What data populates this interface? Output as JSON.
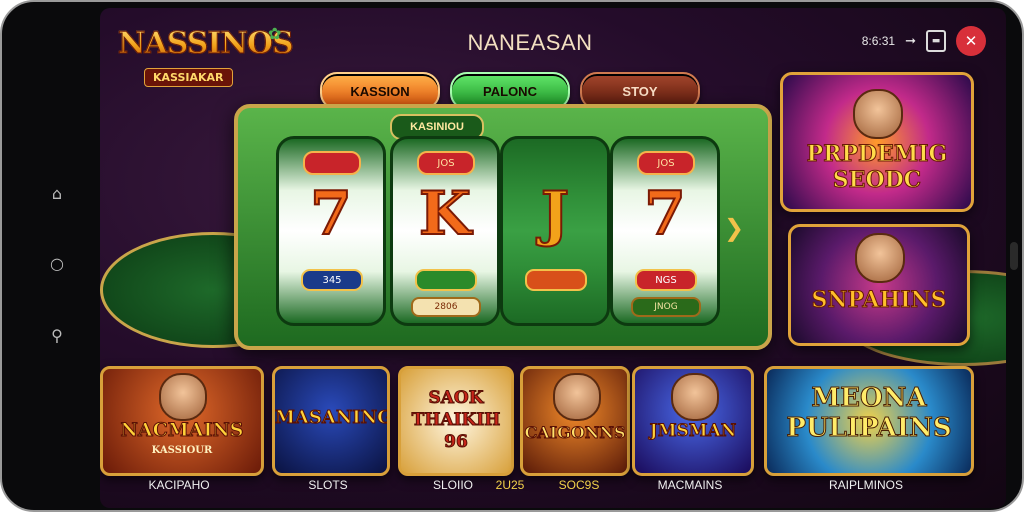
{
  "app": {
    "logo_title": "NASSINOS",
    "logo_subtitle": "KASSIAKAR",
    "title": "NANEASAN"
  },
  "status": {
    "time": "8:6:31"
  },
  "nav": {
    "home_icon": "home-icon",
    "back_icon": "circle-icon",
    "recent_icon": "lock-icon"
  },
  "tabs": [
    {
      "label": "KASSION",
      "color": "#e2560c"
    },
    {
      "label": "PALONC",
      "color": "#1e9a28"
    },
    {
      "label": "STOY",
      "color": "#5c1a0c"
    }
  ],
  "slot": {
    "title": "KASINIOU",
    "reels": [
      {
        "top": "",
        "symbol": "7",
        "bottom": "345",
        "foot": ""
      },
      {
        "top": "JOS",
        "symbol": "K",
        "bottom": "",
        "foot": "2806"
      },
      {
        "top": "",
        "symbol": "J",
        "bottom": "",
        "foot": ""
      },
      {
        "top": "JOS",
        "symbol": "7",
        "bottom": "NGS",
        "foot": "JNOG"
      }
    ]
  },
  "promos": {
    "top": "PRPDEMIG SEODC",
    "middle": "SNPAHINS"
  },
  "bottom_cards": [
    {
      "title": "NACMAINS",
      "sub": "KASSIOUR",
      "label": "KACIPAHO"
    },
    {
      "title": "MASANING",
      "sub": "",
      "label": "SLOTS"
    },
    {
      "title": "SAOK THAIKIH 96",
      "sub": "",
      "label": "SLOIIO"
    },
    {
      "title": "CAIGONNS",
      "sub": "",
      "label": "2U25"
    },
    {
      "title": "JMSMAN",
      "sub": "",
      "label": "MACMAINS"
    },
    {
      "title": "MEONA PULIPAINS",
      "sub": "",
      "label": "RAIPLMINOS"
    }
  ],
  "bottom_extra_label": "SOC9S",
  "colors": {
    "accent_gold": "#e0a33a",
    "close_red": "#d8303a",
    "felt_green": "#1e6a2a"
  }
}
